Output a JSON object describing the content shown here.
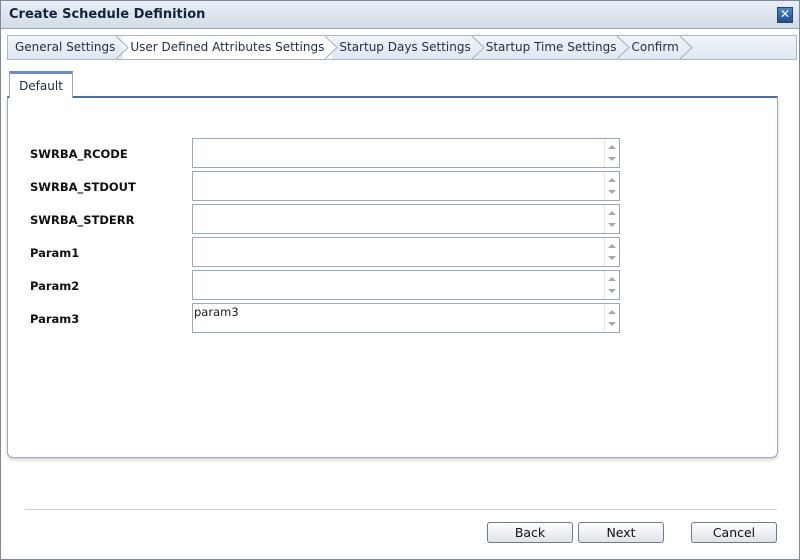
{
  "window": {
    "title": "Create Schedule Definition",
    "close_glyph": "✕"
  },
  "steps": [
    {
      "label": "General Settings",
      "active": false
    },
    {
      "label": "User Defined Attributes Settings",
      "active": true
    },
    {
      "label": "Startup Days Settings",
      "active": false
    },
    {
      "label": "Startup Time Settings",
      "active": false
    },
    {
      "label": "Confirm",
      "active": false
    }
  ],
  "tab": {
    "label": "Default"
  },
  "fields": [
    {
      "label": "SWRBA_RCODE",
      "value": ""
    },
    {
      "label": "SWRBA_STDOUT",
      "value": ""
    },
    {
      "label": "SWRBA_STDERR",
      "value": ""
    },
    {
      "label": "Param1",
      "value": ""
    },
    {
      "label": "Param2",
      "value": ""
    },
    {
      "label": "Param3",
      "value": "param3"
    }
  ],
  "buttons": {
    "back": "Back",
    "next": "Next",
    "cancel": "Cancel"
  },
  "colors": {
    "accent": "#4d6f9c",
    "titlebar": "#d3dce8"
  }
}
